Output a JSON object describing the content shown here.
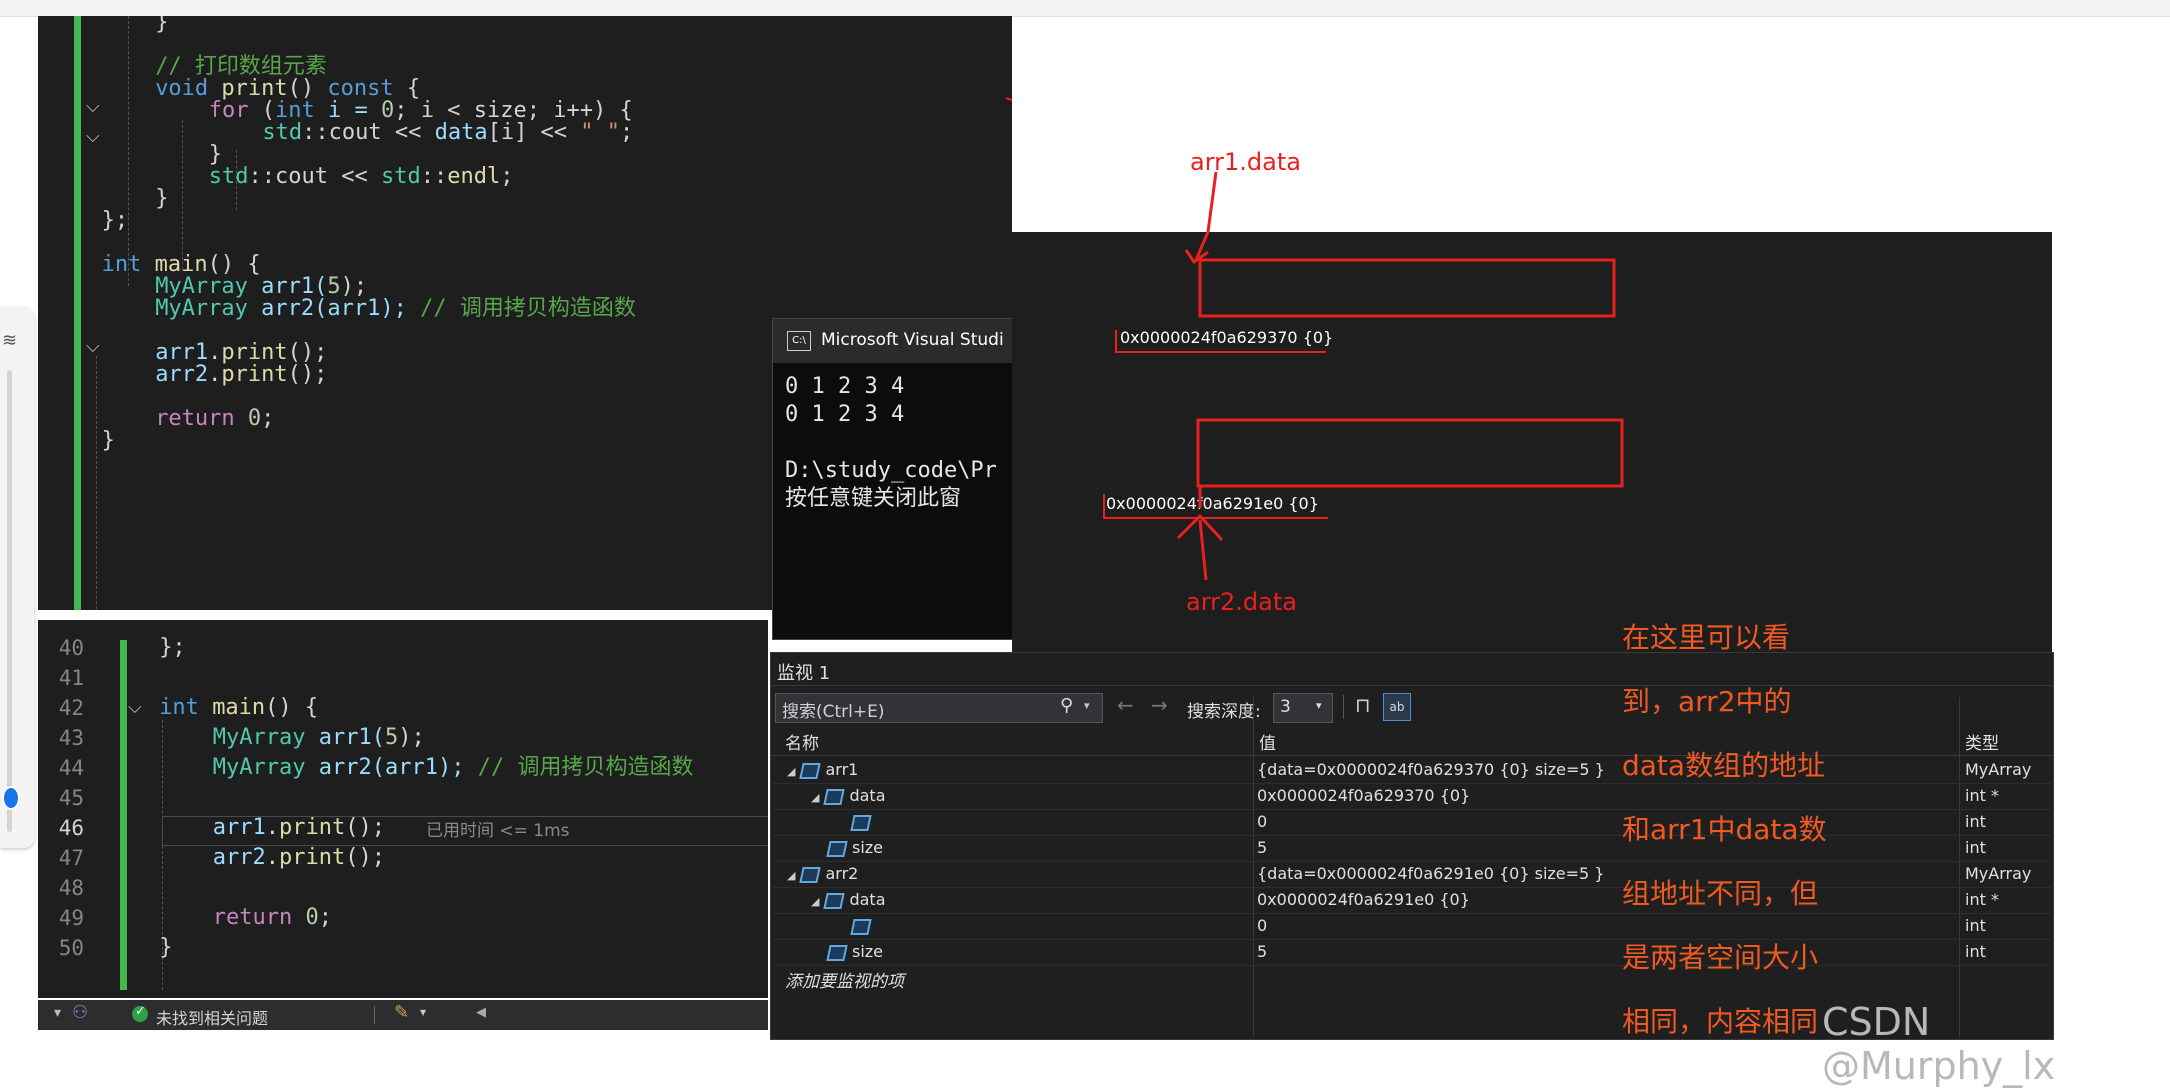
{
  "editor_top": {
    "lines": [
      {
        "segments": [
          {
            "t": "}",
            "c": ""
          }
        ]
      },
      {
        "segments": []
      },
      {
        "segments": [
          {
            "t": "// 打印数组元素",
            "c": "cm"
          }
        ]
      },
      {
        "segments": [
          {
            "t": "void ",
            "c": "kw"
          },
          {
            "t": "print",
            "c": "fn"
          },
          {
            "t": "() ",
            "c": ""
          },
          {
            "t": "const",
            "c": "kw"
          },
          {
            "t": " {",
            "c": ""
          }
        ]
      },
      {
        "segments": [
          {
            "t": "for",
            "c": "kwc"
          },
          {
            "t": " (",
            "c": ""
          },
          {
            "t": "int",
            "c": "kw"
          },
          {
            "t": " i = ",
            "c": "var"
          },
          {
            "t": "0",
            "c": "num"
          },
          {
            "t": "; i < size; i++) {",
            "c": ""
          }
        ]
      },
      {
        "segments": [
          {
            "t": "std",
            "c": "ty"
          },
          {
            "t": "::cout << ",
            "c": ""
          },
          {
            "t": "data",
            "c": "var"
          },
          {
            "t": "[i] << ",
            "c": ""
          },
          {
            "t": "\" \"",
            "c": "str"
          },
          {
            "t": ";",
            "c": ""
          }
        ]
      },
      {
        "segments": [
          {
            "t": "}",
            "c": ""
          }
        ]
      },
      {
        "segments": [
          {
            "t": "std",
            "c": "ty"
          },
          {
            "t": "::cout << ",
            "c": ""
          },
          {
            "t": "std",
            "c": "ty"
          },
          {
            "t": "::",
            "c": ""
          },
          {
            "t": "endl",
            "c": "fn"
          },
          {
            "t": ";",
            "c": ""
          }
        ]
      },
      {
        "segments": [
          {
            "t": "}",
            "c": ""
          }
        ]
      },
      {
        "segments": [
          {
            "t": "};",
            "c": ""
          }
        ]
      },
      {
        "segments": []
      },
      {
        "segments": [
          {
            "t": "int",
            "c": "kw"
          },
          {
            "t": " ",
            "c": ""
          },
          {
            "t": "main",
            "c": "fn"
          },
          {
            "t": "() {",
            "c": ""
          }
        ]
      },
      {
        "segments": [
          {
            "t": "MyArray",
            "c": "ty"
          },
          {
            "t": " arr1(",
            "c": "var"
          },
          {
            "t": "5",
            "c": "num"
          },
          {
            "t": ");",
            "c": ""
          }
        ]
      },
      {
        "segments": [
          {
            "t": "MyArray",
            "c": "ty"
          },
          {
            "t": " arr2(arr1); ",
            "c": "var"
          },
          {
            "t": "// 调用拷贝构造函数",
            "c": "cm"
          }
        ]
      },
      {
        "segments": []
      },
      {
        "segments": [
          {
            "t": "arr1",
            "c": "var"
          },
          {
            "t": ".",
            "c": ""
          },
          {
            "t": "print",
            "c": "fn"
          },
          {
            "t": "();",
            "c": ""
          }
        ]
      },
      {
        "segments": [
          {
            "t": "arr2",
            "c": "var"
          },
          {
            "t": ".",
            "c": ""
          },
          {
            "t": "print",
            "c": "fn"
          },
          {
            "t": "();",
            "c": ""
          }
        ]
      },
      {
        "segments": []
      },
      {
        "segments": [
          {
            "t": "return",
            "c": "kwc"
          },
          {
            "t": " ",
            "c": ""
          },
          {
            "t": "0",
            "c": "num"
          },
          {
            "t": ";",
            "c": ""
          }
        ]
      },
      {
        "segments": [
          {
            "t": "}",
            "c": ""
          }
        ]
      }
    ]
  },
  "editor_bottom": {
    "line_numbers": [
      "40",
      "41",
      "42",
      "43",
      "44",
      "45",
      "46",
      "47",
      "48",
      "49",
      "50"
    ],
    "current_line": "46",
    "lines": [
      {
        "segments": [
          {
            "t": "};",
            "c": ""
          }
        ]
      },
      {
        "segments": []
      },
      {
        "segments": [
          {
            "t": "int",
            "c": "kw"
          },
          {
            "t": " ",
            "c": ""
          },
          {
            "t": "main",
            "c": "fn"
          },
          {
            "t": "() {",
            "c": ""
          }
        ]
      },
      {
        "segments": [
          {
            "t": "MyArray",
            "c": "ty"
          },
          {
            "t": " arr1(",
            "c": "var"
          },
          {
            "t": "5",
            "c": "num"
          },
          {
            "t": ");",
            "c": ""
          }
        ]
      },
      {
        "segments": [
          {
            "t": "MyArray",
            "c": "ty"
          },
          {
            "t": " arr2(arr1); ",
            "c": "var"
          },
          {
            "t": "// 调用拷贝构造函数",
            "c": "cm"
          }
        ]
      },
      {
        "segments": []
      },
      {
        "segments": [
          {
            "t": "arr1",
            "c": "var"
          },
          {
            "t": ".",
            "c": ""
          },
          {
            "t": "print",
            "c": "fn"
          },
          {
            "t": "();",
            "c": ""
          }
        ]
      },
      {
        "segments": [
          {
            "t": "arr2",
            "c": "var"
          },
          {
            "t": ".",
            "c": ""
          },
          {
            "t": "print",
            "c": "fn"
          },
          {
            "t": "();",
            "c": ""
          }
        ]
      },
      {
        "segments": []
      },
      {
        "segments": [
          {
            "t": "return",
            "c": "kwc"
          },
          {
            "t": " ",
            "c": ""
          },
          {
            "t": "0",
            "c": "num"
          },
          {
            "t": ";",
            "c": ""
          }
        ]
      },
      {
        "segments": [
          {
            "t": "}",
            "c": ""
          }
        ]
      }
    ],
    "elapsed_hint": "已用时间 <= 1ms"
  },
  "status_bar": {
    "issues_text": "未找到相关问题"
  },
  "console": {
    "title": "Microsoft Visual Studi",
    "lines": [
      "0 1 2 3 4",
      "0 1 2 3 4",
      "",
      "D:\\study_code\\Pr",
      "按任意键关闭此窗"
    ]
  },
  "diagram": {
    "arr1_label": "arr1.data",
    "arr2_label": "arr2.data",
    "arr1_address": "0x0000024f0a629370 {0}",
    "arr2_address": "0x0000024f0a6291e0 {0}"
  },
  "watch": {
    "title": "监视 1",
    "search_placeholder": "搜索(Ctrl+E)",
    "search_depth_label": "搜索深度:",
    "search_depth_value": "3",
    "columns": {
      "name": "名称",
      "value": "值",
      "type": "类型"
    },
    "rows": [
      {
        "name": "arr1",
        "indent": 0,
        "expander": "◢",
        "value": "{data=0x0000024f0a629370 {0} size=5 }",
        "type": "MyArray"
      },
      {
        "name": "data",
        "indent": 1,
        "expander": "◢",
        "value": "0x0000024f0a629370 {0}",
        "type": "int *"
      },
      {
        "name": "",
        "indent": 2,
        "expander": "",
        "value": "0",
        "type": "int"
      },
      {
        "name": "size",
        "indent": 1,
        "expander": "",
        "value": "5",
        "type": "int"
      },
      {
        "name": "arr2",
        "indent": 0,
        "expander": "◢",
        "value": "{data=0x0000024f0a6291e0 {0} size=5 }",
        "type": "MyArray"
      },
      {
        "name": "data",
        "indent": 1,
        "expander": "◢",
        "value": "0x0000024f0a6291e0 {0}",
        "type": "int *"
      },
      {
        "name": "",
        "indent": 2,
        "expander": "",
        "value": "0",
        "type": "int"
      },
      {
        "name": "size",
        "indent": 1,
        "expander": "",
        "value": "5",
        "type": "int"
      }
    ],
    "add_item_placeholder": "添加要监视的项"
  },
  "annotation_lines": [
    "在这里可以看",
    "到，arr2中的",
    "data数组的地址",
    "和arr1中data数",
    "组地址不同，但",
    "是两者空间大小",
    "相同，内容相同"
  ],
  "watermark": "CSDN @Murphy_lx",
  "colors": {
    "annotation_red": "#e8211f",
    "annotation_orange": "#f05a22",
    "change_bar_green": "#3fb950"
  }
}
